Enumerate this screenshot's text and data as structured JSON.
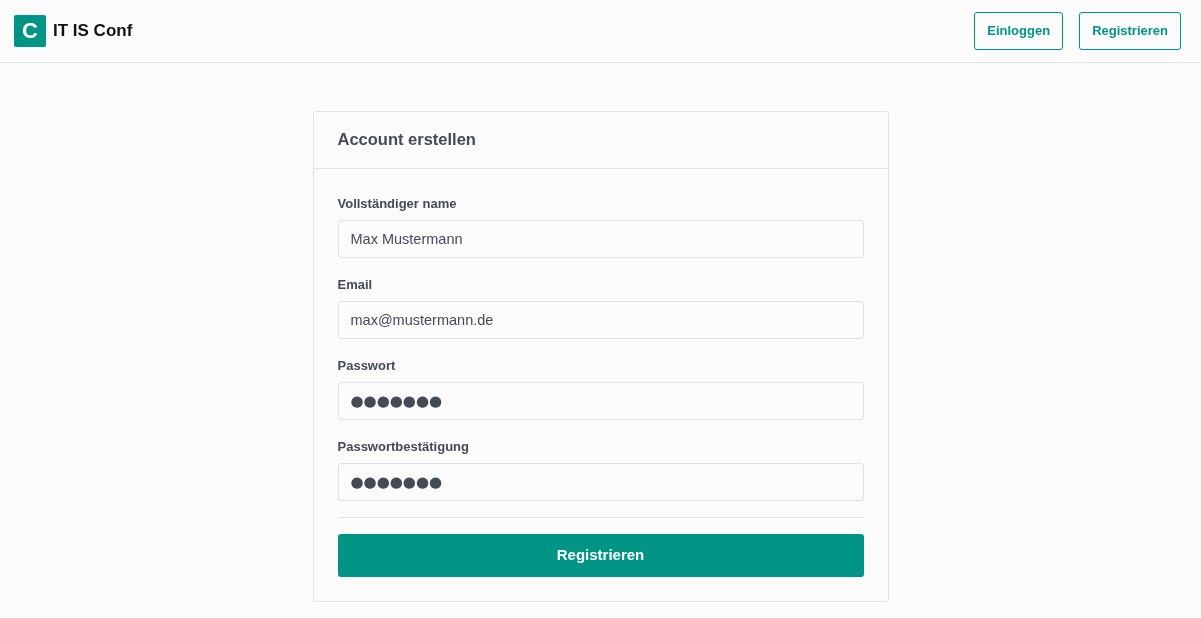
{
  "navbar": {
    "logo_letter": "C",
    "brand": "IT IS Conf",
    "buttons": [
      {
        "label": "Einloggen"
      },
      {
        "label": "Registrieren"
      }
    ]
  },
  "card": {
    "title": "Account erstellen",
    "fields": [
      {
        "kind": "text",
        "label": "Vollständiger name",
        "value": "Max Mustermann"
      },
      {
        "kind": "text",
        "label": "Email",
        "value": "max@mustermann.de"
      },
      {
        "kind": "masked",
        "label": "Passwort",
        "value": "●●●●●●●"
      },
      {
        "kind": "masked",
        "label": "Passwortbestätigung",
        "value": "●●●●●●●"
      }
    ],
    "submit": "Registrieren"
  }
}
